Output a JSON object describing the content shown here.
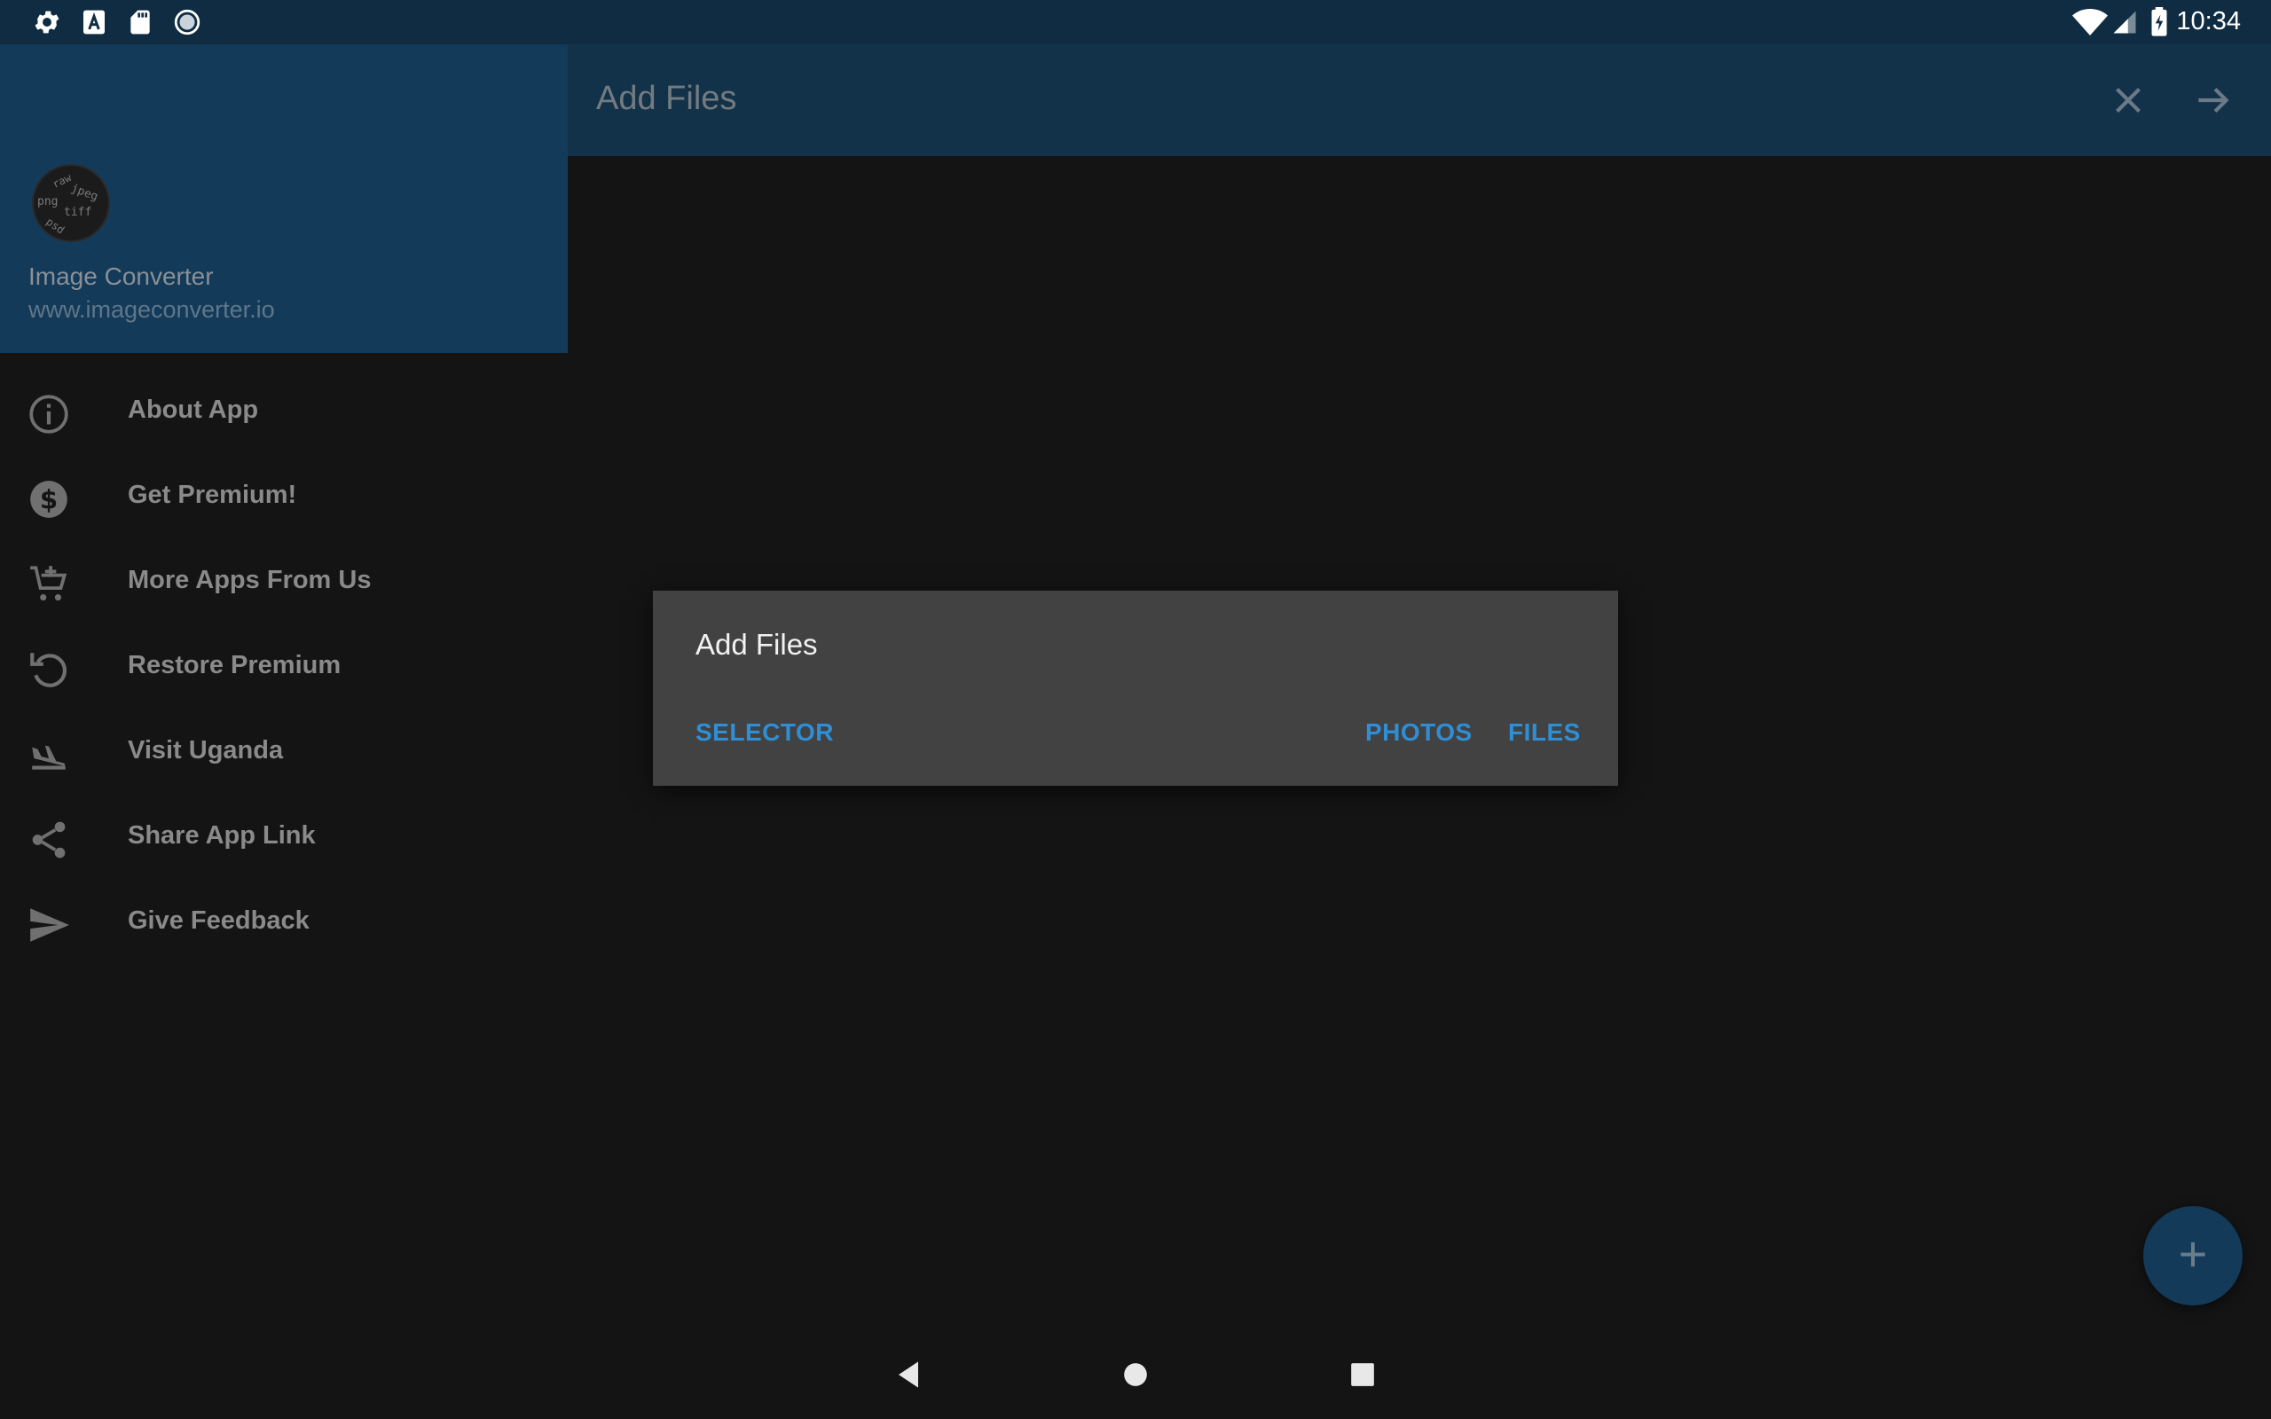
{
  "status_bar": {
    "time": "10:34",
    "left_icons": [
      "settings-icon",
      "font-a-icon",
      "sd-card-icon",
      "sync-circle-icon"
    ],
    "right_icons": [
      "wifi-icon",
      "cellular-signal-icon",
      "battery-charging-icon"
    ]
  },
  "app_bar": {
    "title": "Add Files",
    "actions": [
      "close-icon",
      "arrow-forward-icon"
    ]
  },
  "drawer": {
    "logo_text": "raw jpeg png tiff psd",
    "app_name": "Image Converter",
    "website": "www.imageconverter.io",
    "items": [
      {
        "label": "About App",
        "icon": "info-icon"
      },
      {
        "label": "Get Premium!",
        "icon": "dollar-icon"
      },
      {
        "label": "More Apps From Us",
        "icon": "cart-add-icon"
      },
      {
        "label": "Restore Premium",
        "icon": "restore-icon"
      },
      {
        "label": "Visit Uganda",
        "icon": "flight-land-icon"
      },
      {
        "label": "Share App Link",
        "icon": "share-icon"
      },
      {
        "label": "Give Feedback",
        "icon": "send-icon"
      }
    ]
  },
  "dialog": {
    "title": "Add Files",
    "buttons": {
      "selector": "SELECTOR",
      "photos": "PHOTOS",
      "files": "FILES"
    }
  },
  "fab": {
    "label": "+",
    "icon": "add-icon"
  },
  "nav_bar": [
    "back-icon",
    "home-icon",
    "recents-icon"
  ],
  "colors": {
    "primary": "#133a59",
    "status_bar": "#0f2c42",
    "accent": "#2e8ed6",
    "dialog_bg": "#424242",
    "background": "#141414"
  }
}
